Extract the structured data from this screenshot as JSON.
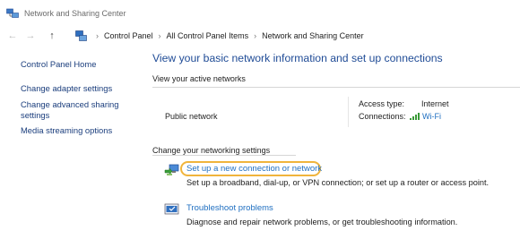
{
  "window": {
    "title": "Network and Sharing Center"
  },
  "breadcrumb": [
    "Control Panel",
    "All Control Panel Items",
    "Network and Sharing Center"
  ],
  "sidebar": {
    "items": [
      {
        "label": "Control Panel Home"
      },
      {
        "label": "Change adapter settings"
      },
      {
        "label": "Change advanced sharing settings"
      },
      {
        "label": "Media streaming options"
      }
    ]
  },
  "main": {
    "heading": "View your basic network information and set up connections",
    "active_networks_label": "View your active networks",
    "network_name": "Public network",
    "access_type_label": "Access type:",
    "access_type_value": "Internet",
    "connections_label": "Connections:",
    "connections_value": "Wi-Fi",
    "change_settings_label": "Change your networking settings",
    "tasks": [
      {
        "link": "Set up a new connection or network",
        "description": "Set up a broadband, dial-up, or VPN connection; or set up a router or access point."
      },
      {
        "link": "Troubleshoot problems",
        "description": "Diagnose and repair network problems, or get troubleshooting information."
      }
    ]
  },
  "colors": {
    "link": "#1f6fc1",
    "heading": "#1f4b96",
    "highlight": "#f0b43c",
    "wifi": "#3a9a38"
  },
  "icons": {
    "window": "network-center-icon",
    "back": "arrow-left-icon",
    "forward": "arrow-right-icon",
    "up": "arrow-up-icon",
    "breadcrumb": "control-panel-icon",
    "setup": "new-connection-icon",
    "troubleshoot": "troubleshoot-icon",
    "connection": "wifi-signal-icon"
  }
}
